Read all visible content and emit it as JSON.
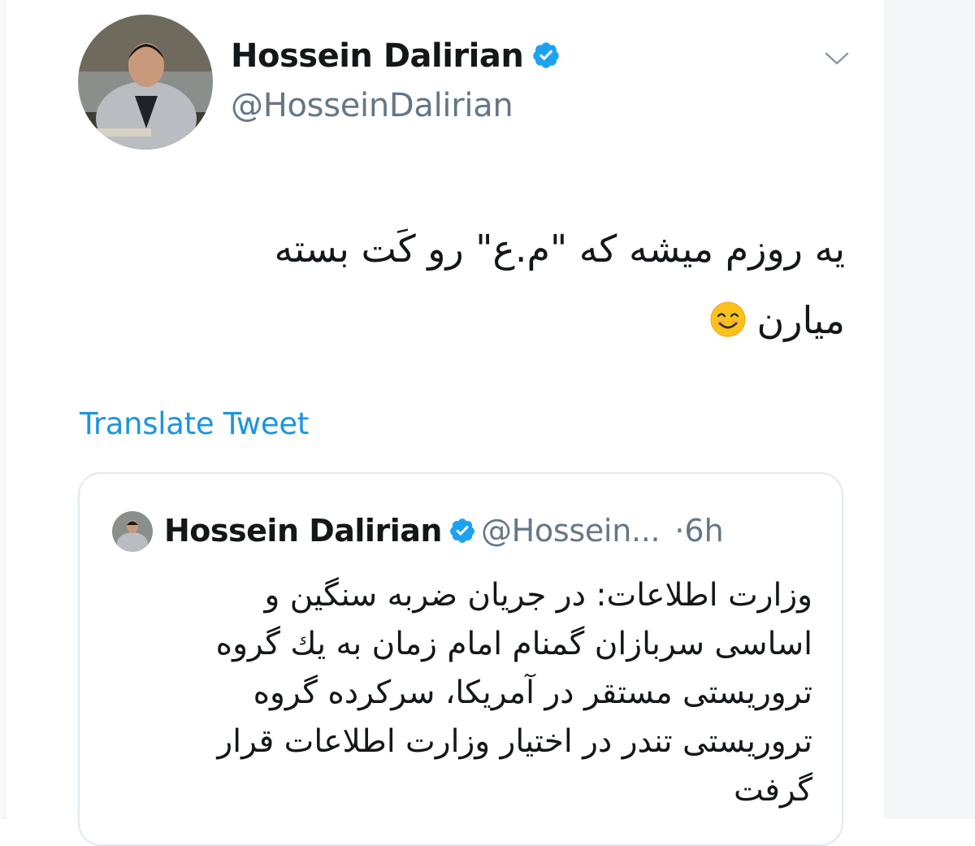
{
  "tweet": {
    "author_name": "Hossein Dalirian",
    "author_handle": "@HosseinDalirian",
    "verified_icon": "verified-badge-icon",
    "menu_icon": "chevron-down-icon",
    "text_lines": [
      "یه روزم میشه که \"م.ع\" رو کَت بسته",
      "میارن"
    ],
    "emoji": "smiling-face-icon",
    "translate_label": "Translate Tweet"
  },
  "quoted_tweet": {
    "author_name": "Hossein Dalirian",
    "author_handle": "@Hossein...",
    "separator": "·",
    "time": "6h",
    "text_lines": [
      "وزارت اطلاعات: در جریان ضربه سنگین و",
      "اساسی سربازان گمنام امام زمان به يك گروه",
      "تروریستی مستقر در آمریکا، سرکرده گروه",
      "تروریستی تندر در اختیار وزارت اطلاعات قرار",
      "گرفت"
    ]
  },
  "colors": {
    "link": "#1b95e0",
    "verified": "#1da1f2",
    "secondary_text": "#657786",
    "border": "#e1e8ed"
  }
}
